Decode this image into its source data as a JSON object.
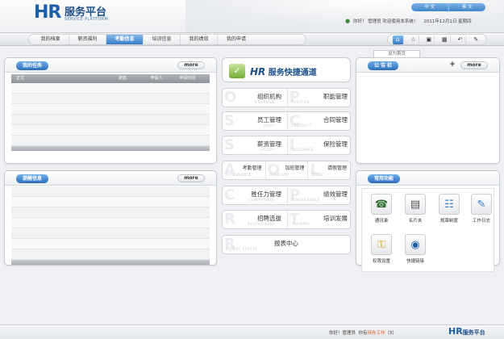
{
  "brand": {
    "logo_text": "HR",
    "title": "服务平台",
    "subtitle": "SERVICE PLATFORM"
  },
  "lang": {
    "zh": "中 文",
    "en": "英 文"
  },
  "userbar": {
    "greeting": "你好！",
    "user": "管理员",
    "welcome": "欢迎使用本系统！",
    "date": "2011年12月1日",
    "weekday": "星期四"
  },
  "nav": {
    "tabs": [
      {
        "label": "我的档案"
      },
      {
        "label": "薪资福利"
      },
      {
        "label": "考勤信息",
        "active": true
      },
      {
        "label": "培训信息"
      },
      {
        "label": "我的绩效"
      },
      {
        "label": "我的申请"
      }
    ],
    "tools": [
      "home-icon",
      "tree-icon",
      "window-icon",
      "save-icon",
      "undo-icon",
      "edit-icon"
    ],
    "tooltip": "设为首页"
  },
  "tasks": {
    "title": "我的任务",
    "more": "more",
    "columns": [
      "正文",
      "状态",
      "申请人",
      "申请时间"
    ],
    "row_count": 6
  },
  "reminders": {
    "title": "提醒信息",
    "more": "more",
    "row_count": 6
  },
  "quick": {
    "title_hr": "HR",
    "title": "服务快捷通道",
    "rows": [
      [
        {
          "label": "组织机构",
          "bg": "O",
          "sub": "ORGANIZE"
        },
        {
          "label": "职能管理",
          "bg": "P",
          "sub": "POSITION"
        }
      ],
      [
        {
          "label": "员工管理",
          "bg": "S",
          "sub": "STAFF"
        },
        {
          "label": "合同管理",
          "bg": "C",
          "sub": "CONTRACT"
        }
      ],
      [
        {
          "label": "薪资管理",
          "bg": "S",
          "sub": "SALARY"
        },
        {
          "label": "保险管理",
          "bg": "I",
          "sub": "INSURANCE"
        }
      ],
      [
        {
          "label": "考勤管理",
          "bg": "A",
          "sub": "ATTENDANCE"
        },
        {
          "label": "加班管理",
          "bg": "O",
          "sub": "OVERTIME"
        },
        {
          "label": "请假管理",
          "bg": "L",
          "sub": "LEAVE"
        }
      ],
      [
        {
          "label": "胜任力管理",
          "bg": "C",
          "sub": "COMPETENCE"
        },
        {
          "label": "绩效管理",
          "bg": "P",
          "sub": "PERFORMANCE"
        }
      ],
      [
        {
          "label": "招聘选拔",
          "bg": "R",
          "sub": "RECRUITMENT"
        },
        {
          "label": "培训发展",
          "bg": "T",
          "sub": "TRAINING"
        }
      ],
      [
        {
          "label": "报表中心",
          "bg": "R",
          "sub": "REPORT CENTER"
        }
      ]
    ]
  },
  "notice": {
    "title": "公 告 栏",
    "plus": "+",
    "more": "more"
  },
  "functions": {
    "title": "常用功能",
    "items": [
      {
        "label": "通讯录",
        "icon": "contacts-icon"
      },
      {
        "label": "名片夹",
        "icon": "card-folder-icon"
      },
      {
        "label": "规章制度",
        "icon": "rules-icon"
      },
      {
        "label": "工作日志",
        "icon": "work-log-icon"
      },
      {
        "label": "权限设置",
        "icon": "lock-icon"
      },
      {
        "label": "快捷链接",
        "icon": "quick-link-icon"
      }
    ]
  },
  "footer": {
    "greeting": "你好！",
    "user": "管理员",
    "pending_prefix": "你有",
    "pending_link": "待办工作",
    "pending_count": "（5）",
    "logo": "HR",
    "logo_title": "服务平台"
  },
  "colors": {
    "accent": "#3a7cc4",
    "brand": "#1a5fa8",
    "highlight": "#d0541f"
  }
}
